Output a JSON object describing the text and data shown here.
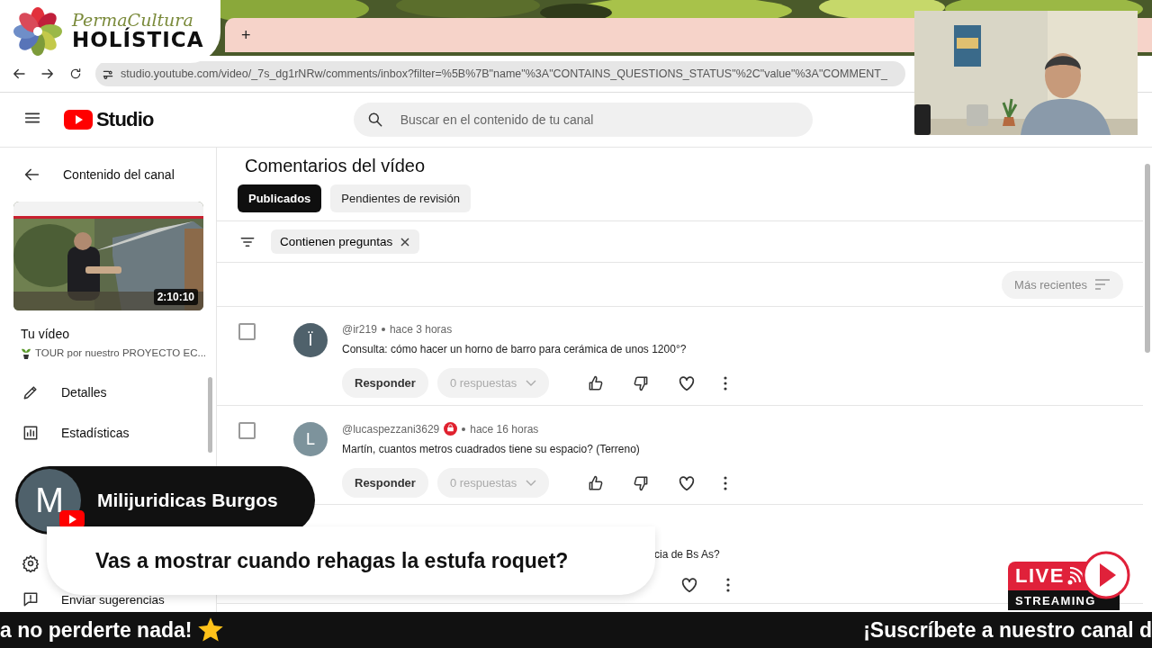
{
  "browser": {
    "new_tab": "+",
    "url": "studio.youtube.com/video/_7s_dg1rNRw/comments/inbox?filter=%5B%7B\"name\"%3A\"CONTAINS_QUESTIONS_STATUS\"%2C\"value\"%3A\"COMMENT_"
  },
  "brand_overlay": {
    "script": "PermaCultura",
    "name": "HOLÍSTICA"
  },
  "studio": {
    "logo": "Studio",
    "search": {
      "placeholder": "Buscar en el contenido de tu canal"
    }
  },
  "sidebar": {
    "back": "Contenido del canal",
    "video": {
      "duration": "2:10:10",
      "heading": "Tu vídeo",
      "title": "TOUR por nuestro PROYECTO EC..."
    },
    "items": [
      {
        "label": "Detalles"
      },
      {
        "label": "Estadísticas"
      }
    ],
    "feedback": "Enviar sugerencias"
  },
  "comments": {
    "title": "Comentarios del vídeo",
    "tabs": [
      {
        "label": "Publicados",
        "selected": true
      },
      {
        "label": "Pendientes de revisión",
        "selected": false
      }
    ],
    "filter_chip": "Contienen preguntas",
    "sort": "Más recientes",
    "items": [
      {
        "kind": "full",
        "checked": false,
        "initial": "Ï",
        "color": "#4f616b",
        "author": "@ir219",
        "badge": false,
        "time": "hace 3 horas",
        "text": "Consulta: cómo hacer un horno de barro para cerámica de unos 1200°?",
        "reply": "Responder",
        "replies": "0 respuestas"
      },
      {
        "kind": "full",
        "checked": false,
        "initial": "L",
        "color": "#7d939c",
        "author": "@lucaspezzani3629",
        "badge": true,
        "time": "hace 16 horas",
        "text": "Martín, cuantos metros cuadrados tiene su espacio? (Terreno)",
        "reply": "Responder",
        "replies": "0 respuestas"
      },
      {
        "kind": "partial",
        "text": "cia de Bs As?"
      }
    ]
  },
  "chat": {
    "initial": "M",
    "author": "Milijuridicas Burgos",
    "message": "Vas a mostrar cuando rehagas la estufa roquet?"
  },
  "live_badge": {
    "live": "LIVE",
    "streaming": "STREAMING"
  },
  "ticker": [
    {
      "text": "a no perderte nada!",
      "star": true
    },
    {
      "text": "¡Suscríbete a nuestro canal d",
      "star": false
    }
  ]
}
